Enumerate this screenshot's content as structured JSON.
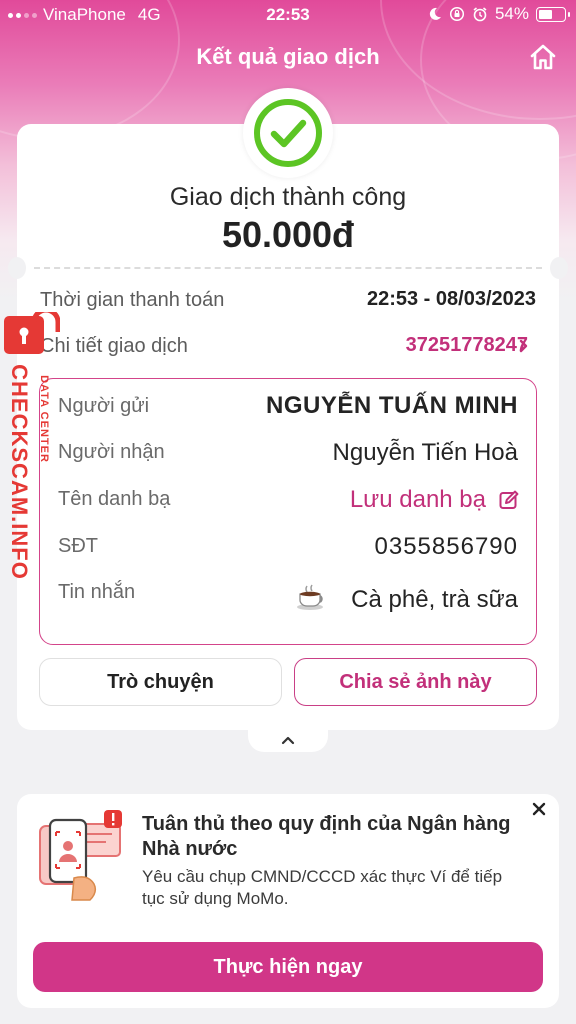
{
  "status_bar": {
    "carrier": "VinaPhone",
    "network": "4G",
    "time": "22:53",
    "battery": "54%",
    "battery_level": 0.54,
    "icons": [
      "moon-icon",
      "orientation-lock-icon",
      "alarm-icon",
      "battery-icon"
    ]
  },
  "header": {
    "title": "Kết quả giao dịch",
    "home_icon": "home-icon"
  },
  "result": {
    "status_icon": "check-circle-icon",
    "status": "Giao dịch thành công",
    "amount": "50.000đ"
  },
  "info": {
    "time_label": "Thời gian thanh toán",
    "time_value": "22:53 - 08/03/2023",
    "detail_label": "Chi tiết giao dịch",
    "detail_value": "37251778247"
  },
  "details": {
    "sender_label": "Người gửi",
    "sender_value": "NGUYỄN TUẤN MINH",
    "receiver_label": "Người nhận",
    "receiver_value": "Nguyễn Tiến Hoà",
    "contact_label": "Tên danh bạ",
    "contact_value": "Lưu danh bạ",
    "phone_label": "SĐT",
    "phone_value": "0355856790",
    "message_label": "Tin nhắn",
    "message_value": "Cà phê, trà sữa"
  },
  "actions": {
    "chat": "Trò chuyện",
    "share": "Chia sẻ ảnh này"
  },
  "banner": {
    "title": "Tuân thủ theo quy định của Ngân hàng Nhà nước",
    "description": "Yêu cầu chụp CMND/CCCD xác thực Ví để tiếp tục sử dụng MoMo.",
    "cta": "Thực hiện ngay"
  },
  "watermark": {
    "main": "CHECKSCAM.INFO",
    "sub": "DATA CENTER"
  },
  "colors": {
    "brand": "#d13688",
    "accent_text": "#c2307a",
    "success": "#5cc524",
    "watermark": "#e53935"
  }
}
